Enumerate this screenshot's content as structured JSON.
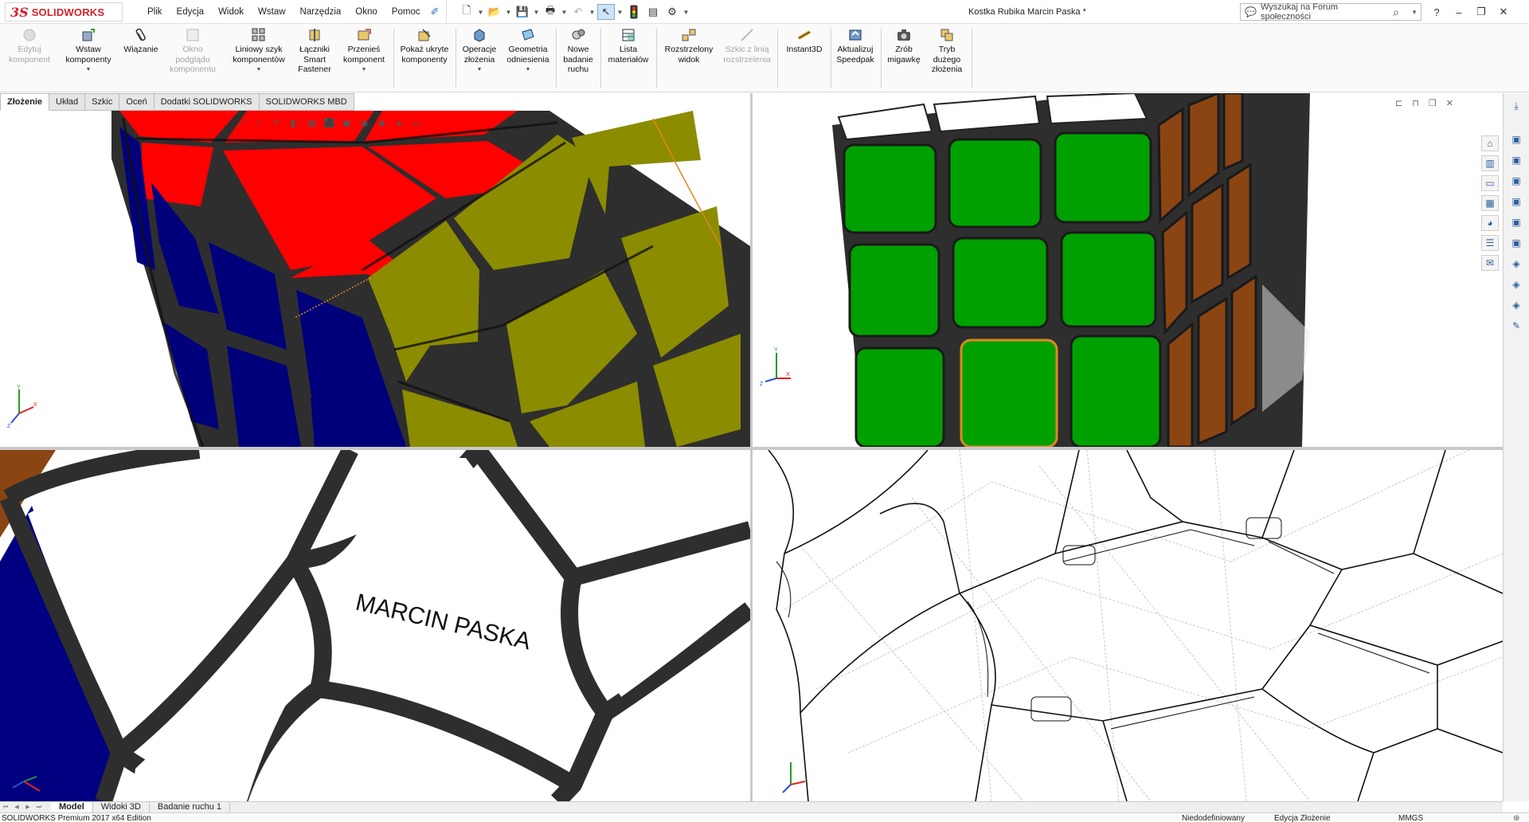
{
  "app": {
    "logo_text": "SOLIDWORKS",
    "document_title": "Kostka Rubika Marcin Paska *"
  },
  "menu": [
    "Plik",
    "Edycja",
    "Widok",
    "Wstaw",
    "Narzędzia",
    "Okno",
    "Pomoc"
  ],
  "search": {
    "placeholder": "Wyszukaj na Forum społeczności"
  },
  "ribbon": {
    "buttons": [
      {
        "label": "Edytuj\nkomponent",
        "enabled": false
      },
      {
        "label": "Wstaw\nkomponenty",
        "enabled": true,
        "dropdown": true
      },
      {
        "label": "Wiązanie",
        "enabled": true
      },
      {
        "label": "Okno\npodglądu\nkomponentu",
        "enabled": false
      },
      {
        "label": "Liniowy szyk\nkomponentów",
        "enabled": true,
        "dropdown": true
      },
      {
        "label": "Łączniki\nSmart\nFastener",
        "enabled": true
      },
      {
        "label": "Przenieś\nkomponent",
        "enabled": true,
        "dropdown": true
      },
      {
        "label": "Pokaż ukryte\nkomponenty",
        "enabled": true
      },
      {
        "label": "Operacje\nzłożenia",
        "enabled": true,
        "dropdown": true
      },
      {
        "label": "Geometria\nodniesienia",
        "enabled": true,
        "dropdown": true
      },
      {
        "label": "Nowe\nbadanie\nruchu",
        "enabled": true
      },
      {
        "label": "Lista\nmateriałów",
        "enabled": true
      },
      {
        "label": "Rozstrzelony\nwidok",
        "enabled": true
      },
      {
        "label": "Szkic z linią\nrozstrzelenia",
        "enabled": false
      },
      {
        "label": "Instant3D",
        "enabled": true
      },
      {
        "label": "Aktualizuj\nSpeedpak",
        "enabled": true
      },
      {
        "label": "Zrób\nmigawkę",
        "enabled": true
      },
      {
        "label": "Tryb\ndużego\nzłożenia",
        "enabled": true
      }
    ]
  },
  "command_tabs": [
    "Złożenie",
    "Układ",
    "Szkic",
    "Oceń",
    "Dodatki SOLIDWORKS",
    "SOLIDWORKS MBD"
  ],
  "viewport_text": {
    "engraving": "MARCIN PASKA"
  },
  "bottom_tabs": [
    "Model",
    "Widoki 3D",
    "Badanie ruchu 1"
  ],
  "status": {
    "left": "SOLIDWORKS Premium 2017 x64 Edition",
    "definition": "Niedodefiniowany",
    "mode": "Edycja Złożenie",
    "units": "MMGS"
  },
  "colors": {
    "red": "#ff0000",
    "yellow": "#8c8c00",
    "blue": "#000080",
    "green": "#00a000",
    "brown": "#8b4513",
    "white": "#ffffff",
    "plastic": "#2a2a2a",
    "accent": "#d6202a"
  },
  "icons": {
    "logo": "ds-solidworks-logo",
    "search": "search-icon",
    "window": [
      "minimize-icon",
      "restore-icon",
      "close-icon"
    ]
  }
}
